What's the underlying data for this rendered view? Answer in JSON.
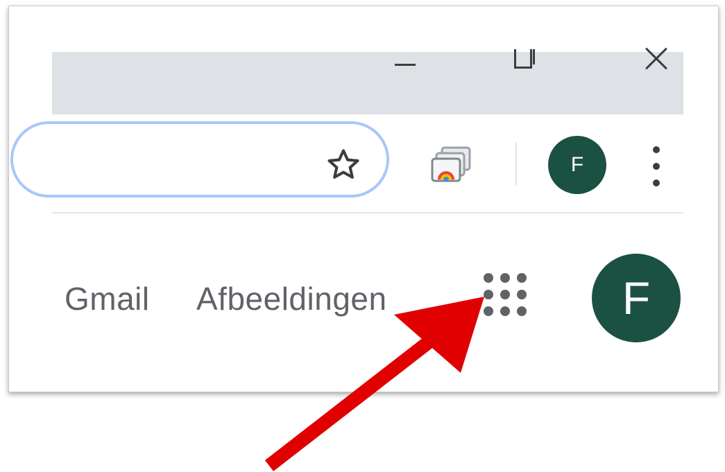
{
  "titlebar": {
    "minimize_label": "Minimize",
    "maximize_label": "Maximize",
    "close_label": "Close"
  },
  "toolbar": {
    "bookmark_icon": "star-icon",
    "cast_icon": "cast-icon",
    "profile_initial": "F",
    "menu_icon": "three-dots-vertical-icon"
  },
  "page": {
    "gmail_link": "Gmail",
    "images_link": "Afbeeldingen",
    "apps_icon": "apps-grid-icon",
    "profile_initial": "F"
  },
  "annotation": {
    "arrow_color": "#e00000",
    "arrow_icon": "arrow-pointer-icon"
  },
  "colors": {
    "titlebar_bg": "#dee1e6",
    "omnibox_border": "#a8c7fa",
    "avatar_bg": "#1b5143",
    "link_text": "#5f6368"
  }
}
